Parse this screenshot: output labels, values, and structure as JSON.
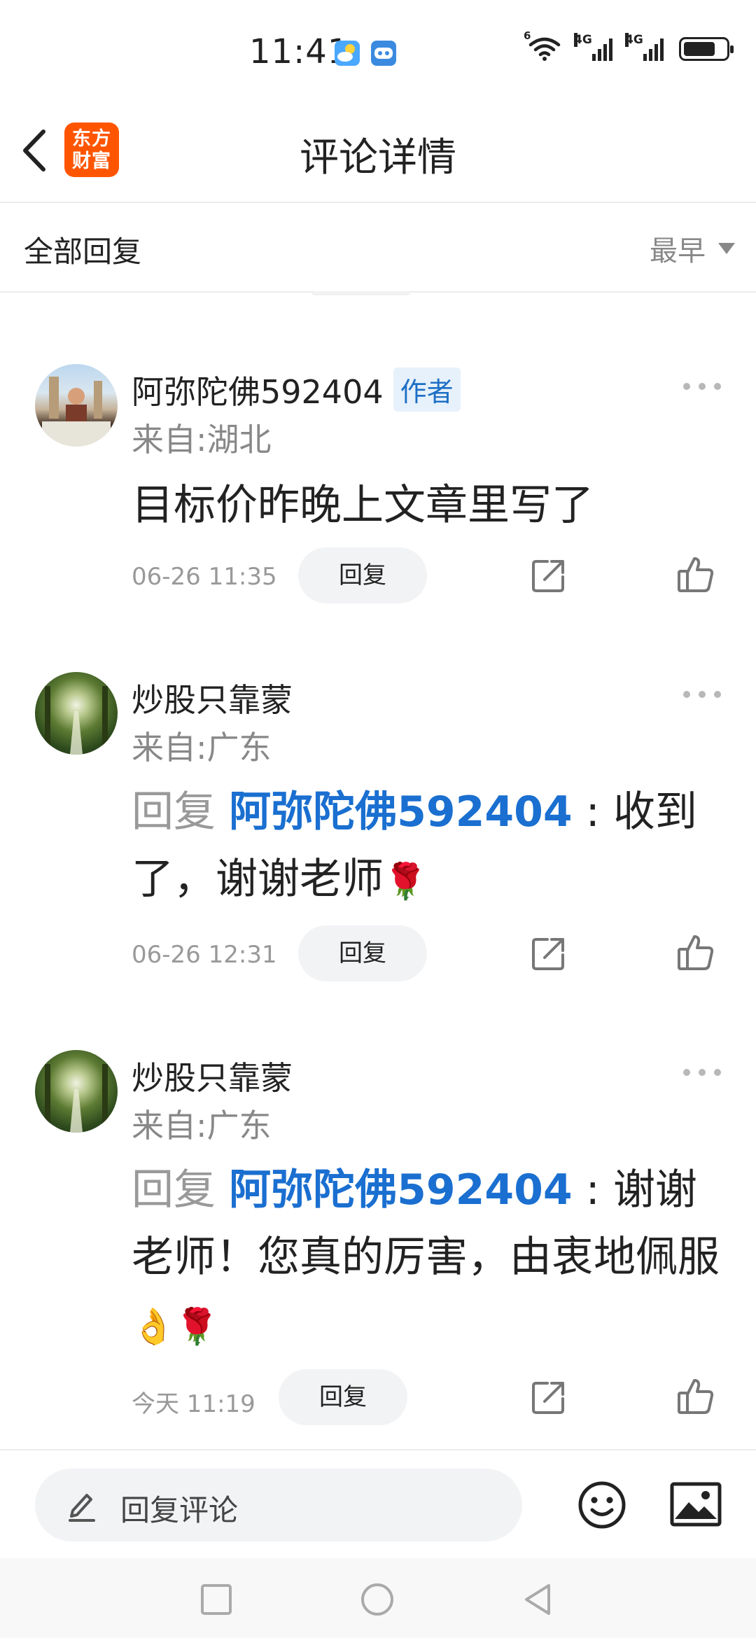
{
  "status_bar": {
    "time": "11:41",
    "app_icons": [
      "weather-icon",
      "game-controller-icon"
    ],
    "wifi_label": "6",
    "sim1_label": "4G",
    "sim2_label": "4G",
    "battery_level": 0.75
  },
  "header": {
    "title": "评论详情",
    "logo_text": [
      "东方",
      "财富"
    ]
  },
  "filter": {
    "label": "全部回复",
    "sort_value": "最早"
  },
  "comments": [
    {
      "username": "阿弥陀佛592404",
      "badge": "作者",
      "location": "来自:湖北",
      "text": "目标价昨晚上文章里写了",
      "time": "06-26 11:35",
      "reply_label": "回复"
    },
    {
      "username": "炒股只靠蒙",
      "location": "来自:广东",
      "reply_prefix": "回复 ",
      "mention": "阿弥陀佛592404",
      "text": " : 收到了，谢谢老师",
      "emojis": "🌹",
      "time": "06-26 12:31",
      "reply_label": "回复"
    },
    {
      "username": "炒股只靠蒙",
      "location": "来自:广东",
      "reply_prefix": "回复 ",
      "mention": "阿弥陀佛592404",
      "text": " : 谢谢老师！您真的厉害，由衷地佩服",
      "emojis": "👌🌹",
      "time": "今天 11:19",
      "reply_label": "回复"
    }
  ],
  "bottom_bar": {
    "reply_placeholder": "回复评论"
  },
  "colors": {
    "accent_blue": "#1a6fd0",
    "logo_orange": "#ff5500",
    "muted_gray": "#999999"
  }
}
